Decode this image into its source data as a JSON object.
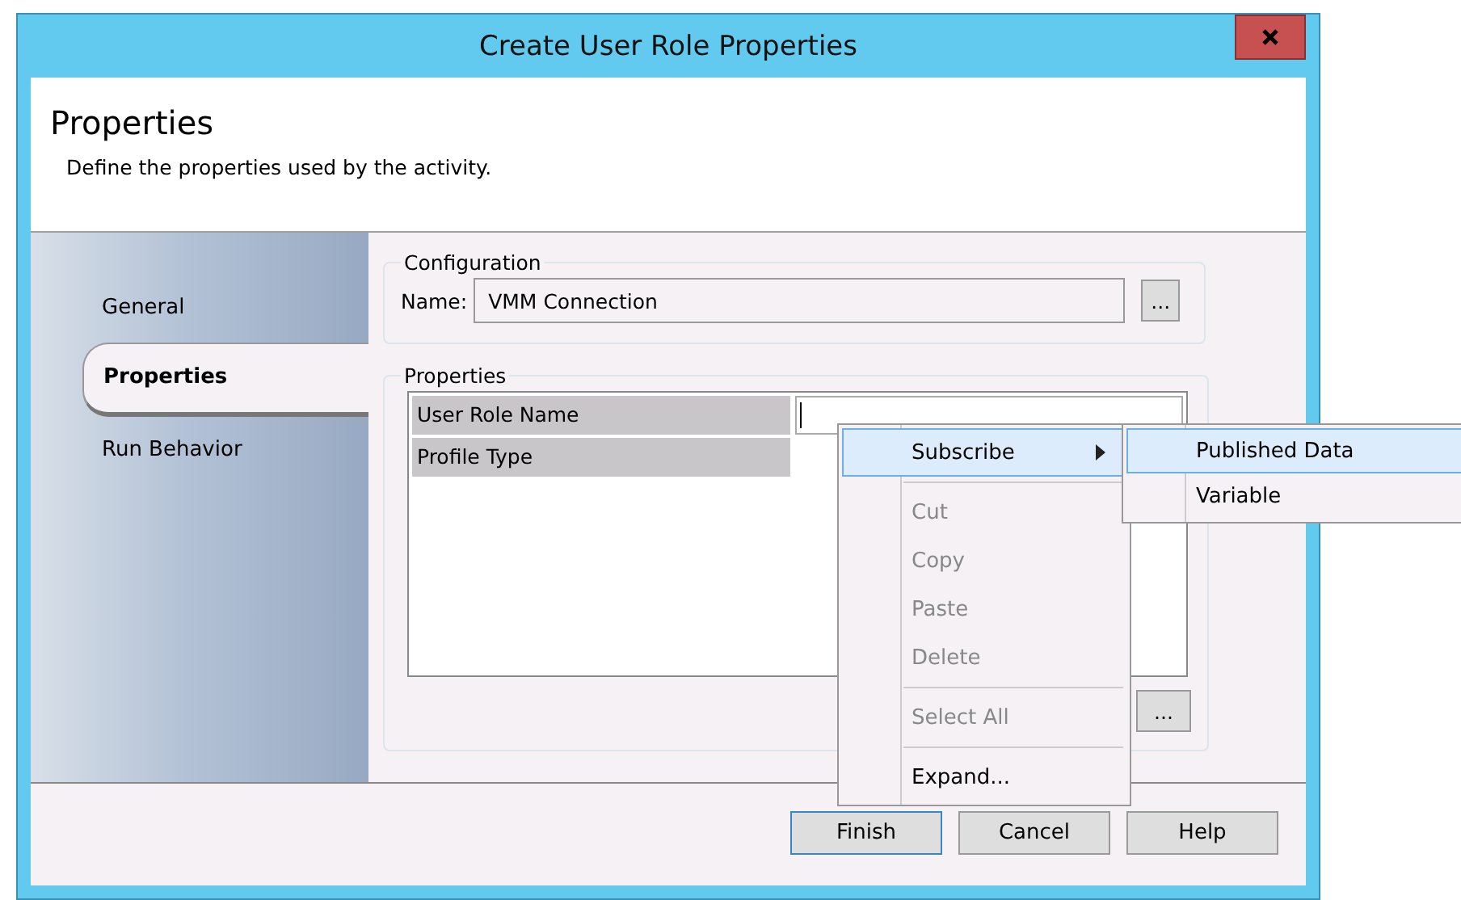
{
  "window": {
    "title": "Create User Role Properties"
  },
  "header": {
    "title": "Properties",
    "subtitle": "Define the properties used by the activity."
  },
  "sidebar": {
    "items": [
      {
        "label": "General",
        "selected": false
      },
      {
        "label": "Properties",
        "selected": true
      },
      {
        "label": "Run Behavior",
        "selected": false
      }
    ]
  },
  "configuration": {
    "title": "Configuration",
    "name_label": "Name:",
    "name_value": "VMM Connection",
    "browse": "..."
  },
  "properties": {
    "title": "Properties",
    "rows": [
      {
        "name": "User Role Name",
        "value": "",
        "focused": true
      },
      {
        "name": "Profile Type",
        "value": "",
        "focused": false
      }
    ],
    "browse": "..."
  },
  "context_menu": {
    "items": [
      {
        "kind": "item",
        "label": "Subscribe",
        "disabled": false,
        "selected": true,
        "submenu": true
      },
      {
        "kind": "separator"
      },
      {
        "kind": "item",
        "label": "Cut",
        "disabled": true,
        "selected": false,
        "submenu": false
      },
      {
        "kind": "item",
        "label": "Copy",
        "disabled": true,
        "selected": false,
        "submenu": false
      },
      {
        "kind": "item",
        "label": "Paste",
        "disabled": true,
        "selected": false,
        "submenu": false
      },
      {
        "kind": "item",
        "label": "Delete",
        "disabled": true,
        "selected": false,
        "submenu": false
      },
      {
        "kind": "separator"
      },
      {
        "kind": "item",
        "label": "Select All",
        "disabled": true,
        "selected": false,
        "submenu": false
      },
      {
        "kind": "separator"
      },
      {
        "kind": "item",
        "label": "Expand...",
        "disabled": false,
        "selected": false,
        "submenu": false
      }
    ]
  },
  "submenu": {
    "items": [
      {
        "label": "Published Data",
        "selected": true
      },
      {
        "label": "Variable",
        "selected": false
      }
    ]
  },
  "buttons": [
    {
      "label": "Finish",
      "default": true
    },
    {
      "label": "Cancel",
      "default": false
    },
    {
      "label": "Help",
      "default": false
    }
  ]
}
